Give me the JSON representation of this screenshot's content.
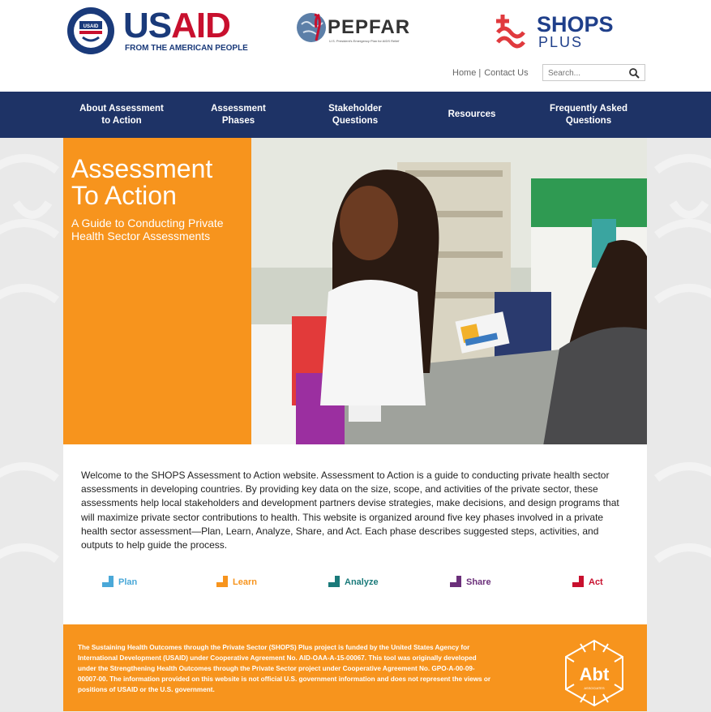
{
  "header": {
    "usaid": {
      "word_blue": "US",
      "word_red": "AID",
      "tagline": "FROM THE AMERICAN PEOPLE",
      "seal_text": "UNITED STATES AGENCY · INTERNATIONAL DEVELOPMENT"
    },
    "pepfar": {
      "word": "PEPFAR",
      "subtitle": "U.S. President's Emergency Plan for AIDS Relief"
    },
    "shops": {
      "word": "SHOPS",
      "plus": "PLUS"
    },
    "links": {
      "home": "Home",
      "contact": "Contact Us"
    },
    "search": {
      "placeholder": "Search..."
    }
  },
  "nav": {
    "items": [
      {
        "label_line1": "About Assessment",
        "label_line2": "to Action"
      },
      {
        "label_line1": "Assessment",
        "label_line2": "Phases"
      },
      {
        "label_line1": "Stakeholder",
        "label_line2": "Questions"
      },
      {
        "label_line1": "Resources",
        "label_line2": ""
      },
      {
        "label_line1": "Frequently Asked",
        "label_line2": "Questions"
      }
    ]
  },
  "hero": {
    "title_line1": "Assessment",
    "title_line2": "To Action",
    "subtitle_line1": "A Guide to Conducting Private",
    "subtitle_line2": "Health Sector Assessments"
  },
  "intro": "Welcome to the SHOPS Assessment to Action website. Assessment to Action is a guide to conducting private health sector assessments in developing countries. By providing key data on the size, scope, and activities of the private sector, these assessments help local stakeholders and development partners devise strategies, make decisions, and design programs that will maximize private sector contributions to health. This website is organized around five key phases involved in a private health sector assessment—Plan, Learn, Analyze, Share, and Act. Each phase describes suggested steps, activities, and outputs to help guide the process.",
  "phases": [
    {
      "label": "Plan",
      "color": "#4aa8d8"
    },
    {
      "label": "Learn",
      "color": "#f7941d"
    },
    {
      "label": "Analyze",
      "color": "#1a7a7a"
    },
    {
      "label": "Share",
      "color": "#6b2f7a"
    },
    {
      "label": "Act",
      "color": "#c8102e"
    }
  ],
  "footer": {
    "text": "The Sustaining Health Outcomes through the Private Sector (SHOPS) Plus project is funded by the United States Agency for International Development (USAID) under Cooperative Agreement No. AID-OAA-A-15-00067. This tool was originally developed under the Strengthening Health Outcomes through the Private Sector project under Cooperative Agreement No. GPO-A-00-09-00007-00. The information provided on this website is not official U.S. government information and does not represent the views or positions of USAID or the U.S. government.",
    "abt_word": "Abt",
    "abt_sub": "ASSOCIATES"
  },
  "colors": {
    "nav_bg": "#1e3366",
    "accent_orange": "#f7941d",
    "usaid_blue": "#1a3a7a",
    "usaid_red": "#c8102e"
  }
}
